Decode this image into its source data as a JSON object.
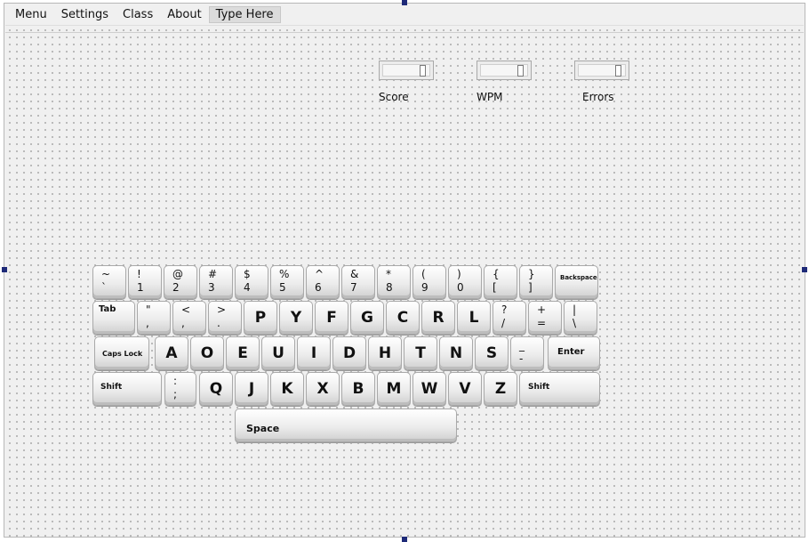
{
  "menu": {
    "items": [
      "Menu",
      "Settings",
      "Class",
      "About",
      "Type Here"
    ]
  },
  "stats": {
    "score_label": "Score",
    "wpm_label": "WPM",
    "errors_label": "Errors",
    "score_value": "",
    "wpm_value": "",
    "errors_value": ""
  },
  "keyboard": {
    "row1": [
      {
        "top": "~",
        "bottom": "`"
      },
      {
        "top": "!",
        "bottom": "1"
      },
      {
        "top": "@",
        "bottom": "2"
      },
      {
        "top": "#",
        "bottom": "3"
      },
      {
        "top": "$",
        "bottom": "4"
      },
      {
        "top": "%",
        "bottom": "5"
      },
      {
        "top": "^",
        "bottom": "6"
      },
      {
        "top": "&",
        "bottom": "7"
      },
      {
        "top": "*",
        "bottom": "8"
      },
      {
        "top": "(",
        "bottom": "9"
      },
      {
        "top": ")",
        "bottom": "0"
      },
      {
        "top": "{",
        "bottom": "["
      },
      {
        "top": "}",
        "bottom": "]"
      }
    ],
    "backspace": "Backspace",
    "tab": "Tab",
    "row2": [
      {
        "top": "\"",
        "bottom": ","
      },
      {
        "top": "<",
        "bottom": ","
      },
      {
        "top": ">",
        "bottom": "."
      },
      {
        "single": "P"
      },
      {
        "single": "Y"
      },
      {
        "single": "F"
      },
      {
        "single": "G"
      },
      {
        "single": "C"
      },
      {
        "single": "R"
      },
      {
        "single": "L"
      },
      {
        "top": "?",
        "bottom": "/"
      },
      {
        "top": "+",
        "bottom": "="
      },
      {
        "top": "|",
        "bottom": "\\"
      }
    ],
    "caps_lock": "Caps Lock",
    "row3": [
      "A",
      "O",
      "E",
      "U",
      "I",
      "D",
      "H",
      "T",
      "N",
      "S"
    ],
    "row3_dash": {
      "top": "_",
      "bottom": "-"
    },
    "enter": "Enter",
    "shift_left": "Shift",
    "row4_colon": {
      "top": ":",
      "bottom": ";"
    },
    "row4": [
      "Q",
      "J",
      "K",
      "X",
      "B",
      "M",
      "W",
      "V",
      "Z"
    ],
    "shift_right": "Shift",
    "space": "Space"
  }
}
